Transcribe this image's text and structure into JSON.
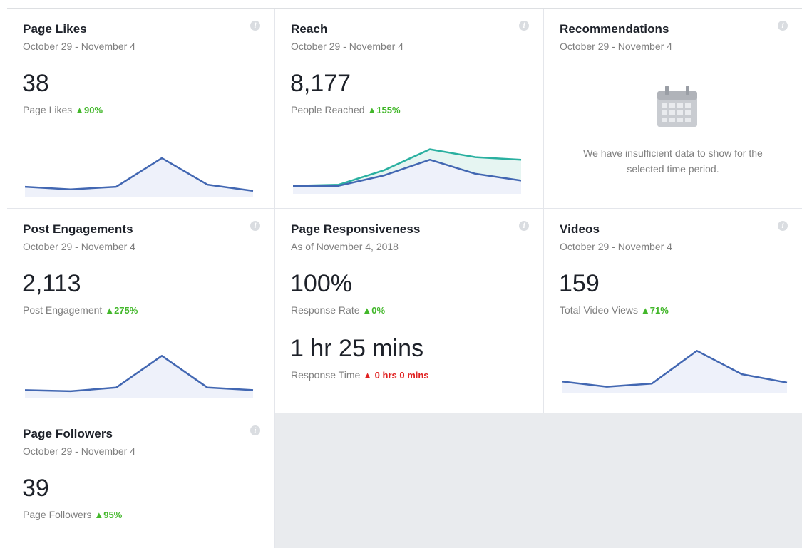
{
  "cards": [
    {
      "title": "Page Likes",
      "date": "October 29 - November 4",
      "value": "38",
      "label": "Page Likes",
      "change": "90%",
      "trend": [
        1.5,
        1.0,
        1.5,
        7.0,
        1.9,
        0.7
      ]
    },
    {
      "title": "Reach",
      "date": "October 29 - November 4",
      "value": "8,177",
      "label": "People Reached",
      "change": "155%",
      "trend_primary": [
        1.0,
        1.0,
        3.0,
        6.0,
        3.3,
        2.0
      ],
      "trend_secondary": [
        1.0,
        1.2,
        4.0,
        8.0,
        6.5,
        6.0
      ]
    },
    {
      "title": "Recommendations",
      "date": "October 29 - November 4",
      "message_line1": "We have insufficient data to show for the",
      "message_line2": "selected time period.",
      "icon": "calendar-icon"
    },
    {
      "title": "Post Engagements",
      "date": "October 29 - November 4",
      "value": "2,113",
      "label": "Post Engagement",
      "change": "275%",
      "trend": [
        0.9,
        0.7,
        1.4,
        7.5,
        1.4,
        0.9
      ]
    },
    {
      "title": "Page Responsiveness",
      "date": "As of November 4, 2018",
      "value": "100%",
      "label": "Response Rate",
      "change": "0%",
      "value2": "1 hr 25 mins",
      "label2": "Response Time",
      "change2": "0 hrs 0 mins"
    },
    {
      "title": "Videos",
      "date": "October 29 - November 4",
      "value": "159",
      "label": "Total Video Views",
      "change": "71%",
      "trend": [
        1.6,
        0.6,
        1.2,
        7.5,
        3.0,
        1.4
      ]
    },
    {
      "title": "Page Followers",
      "date": "October 29 - November 4",
      "value": "39",
      "label": "Page Followers",
      "change": "95%"
    }
  ],
  "info_glyph": "i",
  "up_arrow": "▲",
  "colors": {
    "accent": "#4267b2",
    "fill": "#eef1fa",
    "reach_secondary": "#2ab0a0",
    "up": "#42b72a",
    "down": "#e02121",
    "empty": "#e9ebee"
  }
}
